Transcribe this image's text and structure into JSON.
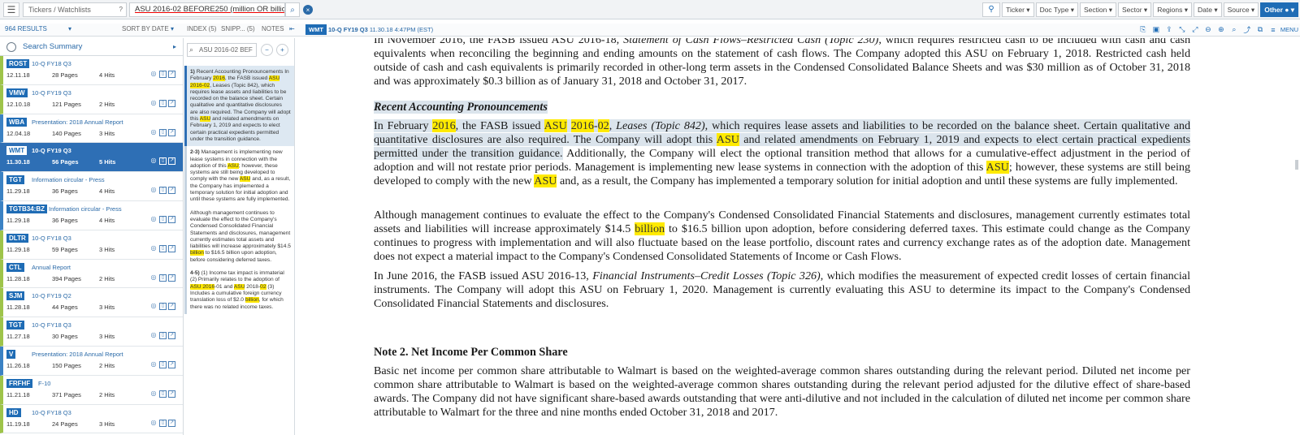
{
  "topbar": {
    "tickers_placeholder": "Tickers / Watchlists",
    "query": "ASU 2016-02 BEFORE250 (million OR billion)",
    "filters": [
      "Ticker",
      "Doc Type",
      "Section",
      "Sector",
      "Regions",
      "Date",
      "Source",
      "Other"
    ]
  },
  "subbar": {
    "results_count": "964 RESULTS",
    "sort_label": "SORT BY DATE",
    "index_tab": "INDEX (5)",
    "snippets_tab": "SNIPP... (5)",
    "notes_tab": "NOTES",
    "doc_ticker": "WMT",
    "doc_type": "10-Q FY19 Q3",
    "doc_timestamp": "11.30.18 4:47PM (EST)",
    "menu_label": "MENU"
  },
  "search_summary": "Search Summary",
  "results": [
    {
      "ticker": "ROST",
      "doctype": "10-Q FY18 Q3",
      "date": "12.11.18",
      "pages": "28 Pages",
      "hits": "4 Hits"
    },
    {
      "ticker": "VMW",
      "doctype": "10-Q FY19 Q3",
      "date": "12.10.18",
      "pages": "121 Pages",
      "hits": "2 Hits"
    },
    {
      "ticker": "WBA",
      "doctype": "Presentation: 2018 Annual Report",
      "date": "12.04.18",
      "pages": "140 Pages",
      "hits": "3 Hits"
    },
    {
      "ticker": "WMT",
      "doctype": "10-Q FY19 Q3",
      "date": "11.30.18",
      "pages": "56 Pages",
      "hits": "5 Hits",
      "selected": true
    },
    {
      "ticker": "TGT",
      "doctype": "Information circular - Press",
      "date": "11.29.18",
      "pages": "36 Pages",
      "hits": "4 Hits"
    },
    {
      "ticker": "TGTB34:BZ",
      "doctype": "Information circular - Press",
      "date": "11.29.18",
      "pages": "36 Pages",
      "hits": "4 Hits"
    },
    {
      "ticker": "DLTR",
      "doctype": "10-Q FY18 Q3",
      "date": "11.29.18",
      "pages": "59 Pages",
      "hits": "3 Hits"
    },
    {
      "ticker": "CTL",
      "doctype": "Annual Report",
      "date": "11.28.18",
      "pages": "394 Pages",
      "hits": "2 Hits"
    },
    {
      "ticker": "SJM",
      "doctype": "10-Q FY19 Q2",
      "date": "11.28.18",
      "pages": "44 Pages",
      "hits": "3 Hits"
    },
    {
      "ticker": "TGT",
      "doctype": "10-Q FY18 Q3",
      "date": "11.27.18",
      "pages": "30 Pages",
      "hits": "3 Hits"
    },
    {
      "ticker": "V",
      "doctype": "Presentation: 2018 Annual Report",
      "date": "11.26.18",
      "pages": "150 Pages",
      "hits": "2 Hits"
    },
    {
      "ticker": "FRFHF",
      "doctype": "F-10",
      "date": "11.21.18",
      "pages": "371 Pages",
      "hits": "2 Hits"
    },
    {
      "ticker": "HD",
      "doctype": "10-Q FY18 Q3",
      "date": "11.19.18",
      "pages": "24 Pages",
      "hits": "3 Hits"
    }
  ],
  "snippets": {
    "search_value": "ASU 2016-02 BEF",
    "items": [
      {
        "num": "1)",
        "parts": [
          "Recent Accounting Pronouncements In February ",
          "2016",
          ", the FASB issued ",
          "ASU 2016-02",
          ", Leases (Topic 842), which requires lease assets and liabilities to be recorded on the balance sheet. Certain qualitative and quantitative disclosures are also required. The Company will adopt this ",
          "ASU",
          " and related amendments on February 1, 2019 and expects to elect certain practical expedients permitted under the transition guidance."
        ]
      },
      {
        "num": "2-3)",
        "parts": [
          "Management is implementing new lease systems in connection with the adoption of this ",
          "ASU",
          "; however, these systems are still being developed to comply with the new ",
          "ASU",
          " and, as a result, the Company has implemented a temporary solution for initial adoption and until these systems are fully implemented."
        ]
      },
      {
        "num": "",
        "parts": [
          "Although management continues to evaluate the effect to the Company's Condensed Consolidated Financial Statements and disclosures, management currently estimates total assets and liabilities will increase approximately $14.5 ",
          "billion",
          " to $16.5 billion upon adoption, before considering deferred taxes."
        ]
      },
      {
        "num": "4-5)",
        "parts": [
          "(1) Income tax impact is immaterial (2) Primarily relates to the adoption of ",
          "ASU 2016",
          "-01 and ",
          "ASU",
          " 2018-",
          "02",
          " (3) Includes a cumulative foreign currency translation loss of $2.0 ",
          "billion",
          ", for which there was no related income taxes."
        ]
      }
    ]
  },
  "document": {
    "top_partial": "In November 2016, the FASB issued ASU 2016-18, Statement of Cash Flows–Restricted Cash (Topic 230), which requires restricted cash to be included with cash and cash equivalents when reconciling the beginning and ending amounts on the statement of cash flows. The Company adopted this ASU on February 1, 2018. Restricted cash held outside of cash and cash equivalents is primarily recorded in other-long term assets in the Condensed Consolidated Balance Sheets and was $30 million as of October 31, 2018 and was approximately $0.3 billion as of January 31, 2018 and October 31, 2017.",
    "heading": "Recent Accounting Pronouncements",
    "para1": [
      "In February ",
      "2016",
      ", the FASB issued ",
      "ASU",
      " ",
      "2016",
      "-",
      "02",
      ", ",
      "Leases (Topic 842)",
      ", which requires lease assets and liabilities to be recorded on the balance sheet.  Certain qualitative and quantitative disclosures are also required.  The Company will adopt this ",
      "ASU",
      " and related amendments on February 1, 2019 and expects to elect certain practical expedients permitted under the transition guidance.",
      "  Additionally, the Company will elect the optional transition method that allows for a cumulative-effect adjustment in the period of adoption and will not restate prior periods.  Management is implementing new lease systems in connection with the adoption of this ",
      "ASU",
      "; however, these systems are still being developed to comply with the new ",
      "ASU",
      " and, as a result, the Company has implemented a temporary solution for initial adoption and until these systems are fully implemented."
    ],
    "para2": [
      "Although management continues to evaluate the effect to the Company's Condensed Consolidated Financial Statements and disclosures, management currently estimates total assets and liabilities will increase approximately $14.5 ",
      "billion",
      " to $16.5 billion upon adoption, before considering deferred taxes.  This estimate could change as the Company continues to progress with implementation and will also fluctuate based on the lease portfolio, discount rates and currency exchange rates as of the adoption date.  Management does not expect a material impact to the Company's Condensed Consolidated Statements of Income or Cash Flows."
    ],
    "para3": [
      "In June 2016, the FASB issued ASU 2016-13, ",
      "Financial Instruments–Credit Losses (Topic 326)",
      ", which modifies the measurement of expected credit losses of certain financial instruments. The Company will adopt this ASU on February 1, 2020. Management is currently evaluating this ASU to determine its impact to the Company's Condensed Consolidated Financial Statements and disclosures."
    ],
    "heading2": "Note 2. Net Income Per Common Share",
    "para4": "Basic net income per common share attributable to Walmart is based on the weighted-average common shares outstanding during the relevant period. Diluted net income per common share attributable to Walmart is based on the weighted-average common shares outstanding during the relevant period adjusted for the dilutive effect of share-based awards. The Company did not have significant share-based awards outstanding that were anti-dilutive and not included in the calculation of diluted net income per common share attributable to Walmart for the three and nine months ended October 31, 2018 and 2017."
  },
  "colors": {
    "accent": "#1f6cb5",
    "highlight": "#ffe800",
    "selected_row": "#2e6fb5",
    "badge_green": "#9ec44a"
  }
}
